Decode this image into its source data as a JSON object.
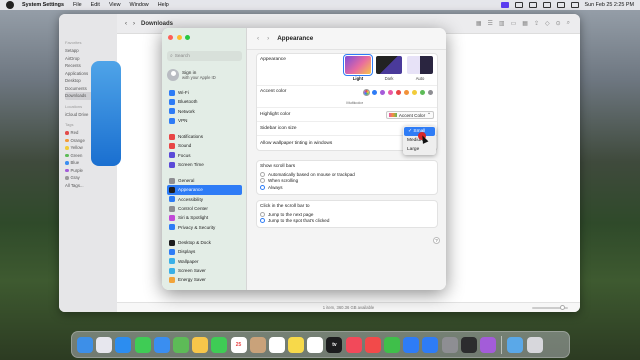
{
  "menubar": {
    "app": "System Settings",
    "menus": [
      "File",
      "Edit",
      "View",
      "Window",
      "Help"
    ],
    "clock": "Sun Feb 25  2:25 PM"
  },
  "finder": {
    "title": "Downloads",
    "status": "1 item, 360.36 GB available",
    "favorites_label": "Favorites",
    "favorites": [
      "Setapp",
      "AirDrop",
      "Recents",
      "Applications",
      "Desktop",
      "Documents",
      "Downloads"
    ],
    "locations_label": "Locations",
    "locations": [
      "iCloud Drive"
    ],
    "tags_label": "Tags",
    "tags": [
      {
        "name": "Red",
        "color": "#e24a4a"
      },
      {
        "name": "Orange",
        "color": "#f29a38"
      },
      {
        "name": "Yellow",
        "color": "#f2cc3a"
      },
      {
        "name": "Green",
        "color": "#5dbb57"
      },
      {
        "name": "Blue",
        "color": "#3a8ef0"
      },
      {
        "name": "Purple",
        "color": "#a35cd9"
      },
      {
        "name": "Gray",
        "color": "#9a9a9a"
      },
      {
        "name": "All Tags...",
        "color": ""
      }
    ]
  },
  "settings": {
    "title": "Appearance",
    "search_placeholder": "Search",
    "signin": {
      "line1": "Sign in",
      "line2": "with your Apple ID"
    },
    "nav_groups": [
      [
        {
          "label": "Wi-Fi",
          "color": "#2e7cf6"
        },
        {
          "label": "Bluetooth",
          "color": "#2e7cf6"
        },
        {
          "label": "Network",
          "color": "#2e7cf6"
        },
        {
          "label": "VPN",
          "color": "#2e7cf6"
        }
      ],
      [
        {
          "label": "Notifications",
          "color": "#e84545"
        },
        {
          "label": "Sound",
          "color": "#e84545"
        },
        {
          "label": "Focus",
          "color": "#5b4ad8"
        },
        {
          "label": "Screen Time",
          "color": "#5b4ad8"
        }
      ],
      [
        {
          "label": "General",
          "color": "#8e8e93"
        },
        {
          "label": "Appearance",
          "color": "#1c1c1e"
        },
        {
          "label": "Accessibility",
          "color": "#2e7cf6"
        },
        {
          "label": "Control Center",
          "color": "#8e8e93"
        },
        {
          "label": "Siri & Spotlight",
          "color": "#c24ad8"
        },
        {
          "label": "Privacy & Security",
          "color": "#2e7cf6"
        }
      ],
      [
        {
          "label": "Desktop & Dock",
          "color": "#1c1c1e"
        },
        {
          "label": "Displays",
          "color": "#2e7cf6"
        },
        {
          "label": "Wallpaper",
          "color": "#3ab0e8"
        },
        {
          "label": "Screen Saver",
          "color": "#3ab0e8"
        },
        {
          "label": "Energy Saver",
          "color": "#f2a43a"
        }
      ]
    ],
    "appearance": {
      "label": "Appearance",
      "options": [
        "Light",
        "Dark",
        "Auto"
      ],
      "selected": "Light"
    },
    "accent": {
      "label": "Accent color",
      "sublabel": "Multicolor",
      "colors": [
        "#7a7a7a",
        "#2e7cf6",
        "#a55bd9",
        "#e95aa6",
        "#e84545",
        "#f2923a",
        "#f2cc3a",
        "#5dbb57",
        "#8e8e93"
      ]
    },
    "highlight": {
      "label": "Highlight color",
      "value": "Accent Color"
    },
    "sidebar_icon": {
      "label": "Sidebar icon size",
      "value": "Small"
    },
    "tinting": {
      "label": "Allow wallpaper tinting in windows"
    },
    "scrollbars": {
      "label": "Show scroll bars",
      "options": [
        "Automatically based on mouse or trackpad",
        "When scrolling",
        "Always"
      ],
      "selected": 2
    },
    "scrollclick": {
      "label": "Click in the scroll bar to",
      "options": [
        "Jump to the next page",
        "Jump to the spot that's clicked"
      ],
      "selected": 1
    },
    "help": "?"
  },
  "dropdown": {
    "options": [
      "Small",
      "Medium",
      "Large"
    ],
    "checked": "✓"
  },
  "dock": {
    "items": [
      {
        "name": "finder-icon",
        "color": "#3d8fe8"
      },
      {
        "name": "launchpad-icon",
        "color": "#e7e7ee"
      },
      {
        "name": "safari-icon",
        "color": "#2c8df0"
      },
      {
        "name": "messages-icon",
        "color": "#3fcc55"
      },
      {
        "name": "mail-icon",
        "color": "#3a8ef0"
      },
      {
        "name": "maps-icon",
        "color": "#5dbb57"
      },
      {
        "name": "photos-icon",
        "color": "#f7c64a"
      },
      {
        "name": "facetime-icon",
        "color": "#3fcc55"
      },
      {
        "name": "calendar-icon",
        "color": "#ffffff",
        "text": "25"
      },
      {
        "name": "contacts-icon",
        "color": "#c9a27a"
      },
      {
        "name": "reminders-icon",
        "color": "#ffffff"
      },
      {
        "name": "notes-icon",
        "color": "#f7d94a"
      },
      {
        "name": "freeform-icon",
        "color": "#ffffff"
      },
      {
        "name": "tv-icon",
        "color": "#1c1c1e",
        "text": "tv"
      },
      {
        "name": "music-icon",
        "color": "#f2495a"
      },
      {
        "name": "news-icon",
        "color": "#f24a4a"
      },
      {
        "name": "numbers-icon",
        "color": "#3fbf4a"
      },
      {
        "name": "keynote-icon",
        "color": "#2e7cf6"
      },
      {
        "name": "appstore-icon",
        "color": "#2e7cf6"
      },
      {
        "name": "system-settings-icon",
        "color": "#8e8e93"
      },
      {
        "name": "iphone-mirroring-icon",
        "color": "#2c2c2e"
      },
      {
        "name": "setapp-icon",
        "color": "#a35cd9"
      },
      {
        "name": "downloads-folder-icon",
        "color": "#5aa8e8"
      },
      {
        "name": "trash-icon",
        "color": "#d7d7dc"
      }
    ]
  }
}
